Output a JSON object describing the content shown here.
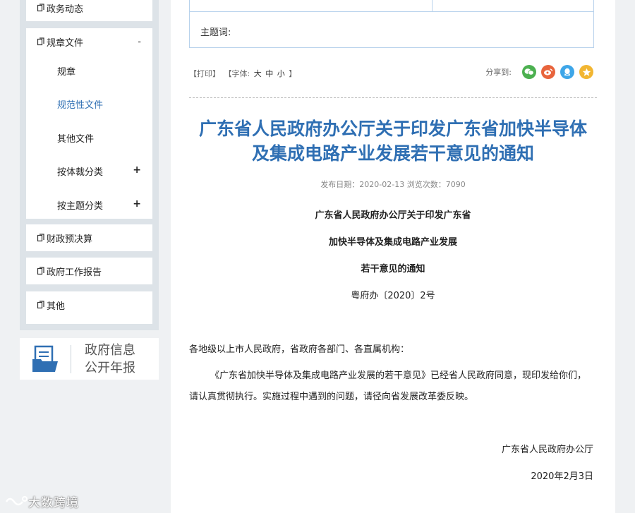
{
  "sidebar": {
    "items": [
      {
        "label": "政务动态"
      },
      {
        "label": "规章文件",
        "toggle": "-"
      },
      {
        "label": "财政预决算"
      },
      {
        "label": "政府工作报告"
      },
      {
        "label": "其他"
      }
    ],
    "sub_items": [
      {
        "label": "规章"
      },
      {
        "label": "规范性文件",
        "active": true
      },
      {
        "label": "其他文件"
      },
      {
        "label": "按体裁分类",
        "toggle": "+"
      },
      {
        "label": "按主题分类",
        "toggle": "+"
      }
    ],
    "report_banner": {
      "line1": "政府信息",
      "line2": "公开年报",
      "icon": "document-folder-icon"
    }
  },
  "meta_table": {
    "keyword_label": "主题词:"
  },
  "toolbar": {
    "print": "【打印】",
    "font_prefix": "【字体:",
    "font_large": "大",
    "font_medium": "中",
    "font_small": "小",
    "font_suffix": "】",
    "share_label": "分享到:",
    "share_buttons": [
      {
        "name": "wechat-icon",
        "color": "#4cb050"
      },
      {
        "name": "weibo-icon",
        "color": "#e8643c"
      },
      {
        "name": "qq-icon",
        "color": "#3ea6e8"
      },
      {
        "name": "qzone-icon",
        "color": "#f2b632"
      }
    ]
  },
  "article": {
    "title_line1": "广东省人民政府办公厅关于印发广东省加快半导体",
    "title_line2": "及集成电路产业发展若干意见的通知",
    "pub_info": "发布日期：2020-02-13  浏览次数：7090",
    "subtitle_line1": "广东省人民政府办公厅关于印发广东省",
    "subtitle_line2": "加快半导体及集成电路产业发展",
    "subtitle_line3": "若干意见的通知",
    "doc_number": "粤府办〔2020〕2号",
    "recipients": "各地级以上市人民政府，省政府各部门、各直属机构：",
    "body_line1": "《广东省加快半导体及集成电路产业发展的若干意见》已经省人民政府同意，现印发给你们，",
    "body_line2": "请认真贯彻执行。实施过程中遇到的问题，请径向省发展改革委反映。",
    "issuer": "广东省人民政府办公厅",
    "date": "2020年2月3日"
  },
  "watermark": "大数跨境",
  "colors": {
    "accent": "#2f6fb3",
    "border": "#b8d2ec",
    "sidebar_bg": "#dde3e8"
  }
}
